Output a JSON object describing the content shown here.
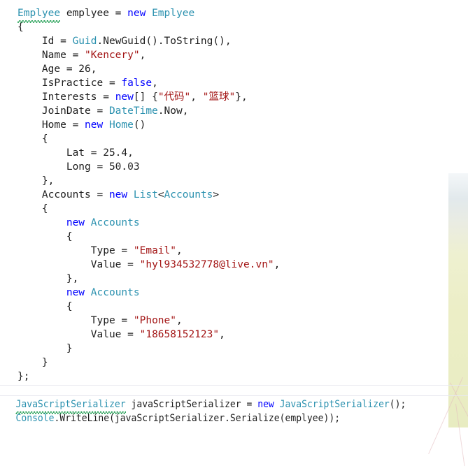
{
  "editor": {
    "language": "csharp",
    "colors": {
      "background": "#ffffff",
      "plain_text": "#1e1e1e",
      "keyword": "#0000ff",
      "type": "#2b91af",
      "string": "#a31515",
      "error_squiggle": "#1c9c4f",
      "separator": "#e8e8ef",
      "watermark_green": "#ecee c6"
    }
  },
  "code": {
    "main_lines": [
      {
        "indent": 0,
        "tokens": [
          {
            "t": "Emplyee",
            "c": "type",
            "squiggle": true
          },
          {
            "t": " emplyee = ",
            "c": "plain"
          },
          {
            "t": "new",
            "c": "kw"
          },
          {
            "t": " ",
            "c": "plain"
          },
          {
            "t": "Emplyee",
            "c": "type"
          }
        ]
      },
      {
        "indent": 0,
        "tokens": [
          {
            "t": "{",
            "c": "punc"
          }
        ]
      },
      {
        "indent": 1,
        "tokens": [
          {
            "t": "Id = ",
            "c": "plain"
          },
          {
            "t": "Guid",
            "c": "type"
          },
          {
            "t": ".NewGuid().ToString(),",
            "c": "plain"
          }
        ]
      },
      {
        "indent": 1,
        "tokens": [
          {
            "t": "Name = ",
            "c": "plain"
          },
          {
            "t": "\"Kencery\"",
            "c": "str"
          },
          {
            "t": ",",
            "c": "plain"
          }
        ]
      },
      {
        "indent": 1,
        "tokens": [
          {
            "t": "Age = 26,",
            "c": "plain"
          }
        ]
      },
      {
        "indent": 1,
        "tokens": [
          {
            "t": "IsPractice = ",
            "c": "plain"
          },
          {
            "t": "false",
            "c": "kw"
          },
          {
            "t": ",",
            "c": "plain"
          }
        ]
      },
      {
        "indent": 1,
        "tokens": [
          {
            "t": "Interests = ",
            "c": "plain"
          },
          {
            "t": "new",
            "c": "kw"
          },
          {
            "t": "[] {",
            "c": "plain"
          },
          {
            "t": "\"代码\"",
            "c": "str"
          },
          {
            "t": ", ",
            "c": "plain"
          },
          {
            "t": "\"篮球\"",
            "c": "str"
          },
          {
            "t": "},",
            "c": "plain"
          }
        ]
      },
      {
        "indent": 1,
        "tokens": [
          {
            "t": "JoinDate = ",
            "c": "plain"
          },
          {
            "t": "DateTime",
            "c": "type"
          },
          {
            "t": ".Now,",
            "c": "plain"
          }
        ]
      },
      {
        "indent": 1,
        "tokens": [
          {
            "t": "Home = ",
            "c": "plain"
          },
          {
            "t": "new",
            "c": "kw"
          },
          {
            "t": " ",
            "c": "plain"
          },
          {
            "t": "Home",
            "c": "type"
          },
          {
            "t": "()",
            "c": "plain"
          }
        ]
      },
      {
        "indent": 1,
        "tokens": [
          {
            "t": "{",
            "c": "punc"
          }
        ]
      },
      {
        "indent": 2,
        "tokens": [
          {
            "t": "Lat = 25.4,",
            "c": "plain"
          }
        ]
      },
      {
        "indent": 2,
        "tokens": [
          {
            "t": "Long = 50.03",
            "c": "plain"
          }
        ]
      },
      {
        "indent": 1,
        "tokens": [
          {
            "t": "},",
            "c": "punc"
          }
        ]
      },
      {
        "indent": 1,
        "tokens": [
          {
            "t": "Accounts = ",
            "c": "plain"
          },
          {
            "t": "new",
            "c": "kw"
          },
          {
            "t": " ",
            "c": "plain"
          },
          {
            "t": "List",
            "c": "type"
          },
          {
            "t": "<",
            "c": "plain"
          },
          {
            "t": "Accounts",
            "c": "type"
          },
          {
            "t": ">",
            "c": "plain"
          }
        ]
      },
      {
        "indent": 1,
        "tokens": [
          {
            "t": "{",
            "c": "punc"
          }
        ]
      },
      {
        "indent": 2,
        "tokens": [
          {
            "t": "new",
            "c": "kw"
          },
          {
            "t": " ",
            "c": "plain"
          },
          {
            "t": "Accounts",
            "c": "type"
          }
        ]
      },
      {
        "indent": 2,
        "tokens": [
          {
            "t": "{",
            "c": "punc"
          }
        ]
      },
      {
        "indent": 3,
        "tokens": [
          {
            "t": "Type = ",
            "c": "plain"
          },
          {
            "t": "\"Email\"",
            "c": "str"
          },
          {
            "t": ",",
            "c": "plain"
          }
        ]
      },
      {
        "indent": 3,
        "tokens": [
          {
            "t": "Value = ",
            "c": "plain"
          },
          {
            "t": "\"hyl934532778@live.vn\"",
            "c": "str"
          },
          {
            "t": ",",
            "c": "plain"
          }
        ]
      },
      {
        "indent": 2,
        "tokens": [
          {
            "t": "},",
            "c": "punc"
          }
        ]
      },
      {
        "indent": 2,
        "tokens": [
          {
            "t": "new",
            "c": "kw"
          },
          {
            "t": " ",
            "c": "plain"
          },
          {
            "t": "Accounts",
            "c": "type"
          }
        ]
      },
      {
        "indent": 2,
        "tokens": [
          {
            "t": "{",
            "c": "punc"
          }
        ]
      },
      {
        "indent": 3,
        "tokens": [
          {
            "t": "Type = ",
            "c": "plain"
          },
          {
            "t": "\"Phone\"",
            "c": "str"
          },
          {
            "t": ",",
            "c": "plain"
          }
        ]
      },
      {
        "indent": 3,
        "tokens": [
          {
            "t": "Value = ",
            "c": "plain"
          },
          {
            "t": "\"18658152123\"",
            "c": "str"
          },
          {
            "t": ",",
            "c": "plain"
          }
        ]
      },
      {
        "indent": 2,
        "tokens": [
          {
            "t": "}",
            "c": "punc"
          }
        ]
      },
      {
        "indent": 1,
        "tokens": [
          {
            "t": "}",
            "c": "punc"
          }
        ]
      },
      {
        "indent": 0,
        "tokens": [
          {
            "t": "};",
            "c": "punc"
          }
        ]
      }
    ],
    "footer_lines": [
      {
        "indent": 0,
        "tokens": [
          {
            "t": "JavaScriptSerializer",
            "c": "type",
            "squiggle": true
          },
          {
            "t": " javaScriptSerializer = ",
            "c": "plain"
          },
          {
            "t": "new",
            "c": "kw"
          },
          {
            "t": " ",
            "c": "plain"
          },
          {
            "t": "JavaScriptSerializer",
            "c": "type"
          },
          {
            "t": "();",
            "c": "plain"
          }
        ]
      },
      {
        "indent": 0,
        "tokens": [
          {
            "t": "Console",
            "c": "type"
          },
          {
            "t": ".WriteLine(javaScriptSerializer.Serialize(emplyee));",
            "c": "plain"
          }
        ]
      }
    ]
  }
}
